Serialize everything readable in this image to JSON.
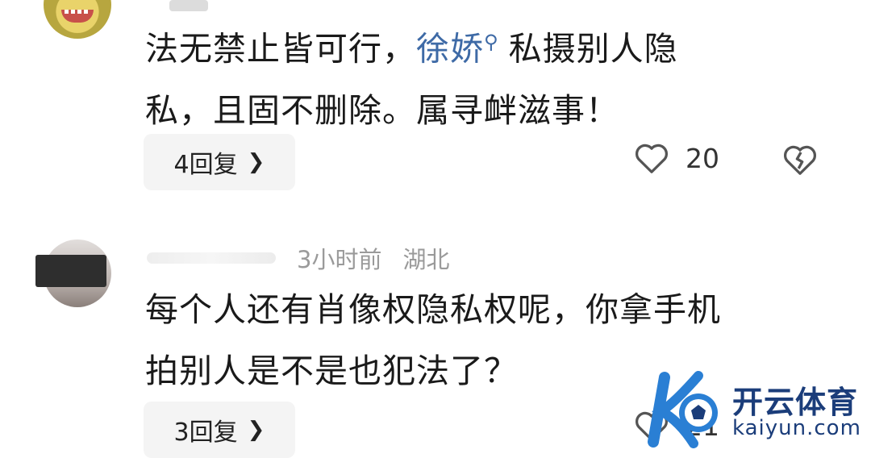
{
  "comments": [
    {
      "text_plain_1": "法无禁止皆可行，",
      "mention": "徐娇",
      "text_plain_2": "私摄别人隐",
      "text_line_2": "私，且固不删除。属寻衅滋事！",
      "reply_label": "4回复",
      "likes": "20"
    },
    {
      "time": "3小时前",
      "location": "湖北",
      "text_line_1": "每个人还有肖像权隐私权呢，你拿手机",
      "text_line_2": "拍别人是不是也犯法了？",
      "reply_label": "3回复",
      "likes": "21"
    }
  ],
  "icons": {
    "like": "heart-outline-icon",
    "dislike": "broken-heart-icon",
    "chevron": "chevron-right-icon",
    "mention": "search-icon"
  },
  "watermark": {
    "brand": "开云体育",
    "domain": "kaiyun.com"
  },
  "colors": {
    "mention": "#3e6aa6",
    "meta": "#9a9a9a",
    "button_bg": "#f4f4f4",
    "watermark": "#1b3d7a"
  }
}
